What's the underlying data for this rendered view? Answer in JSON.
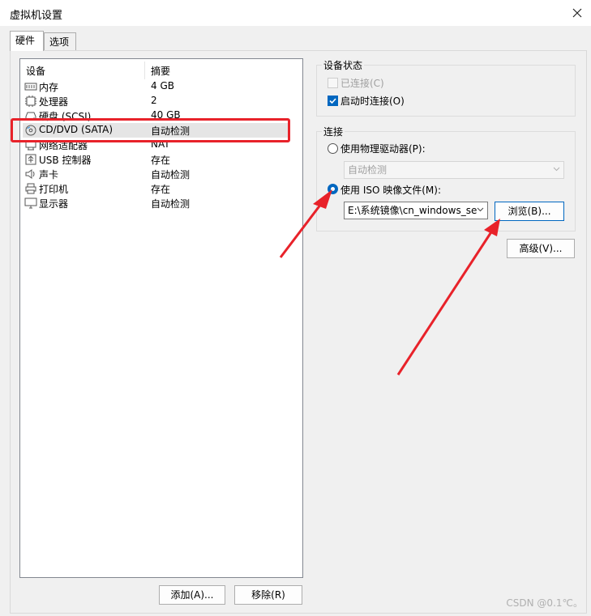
{
  "window": {
    "title": "虚拟机设置"
  },
  "tabs": [
    {
      "label": "硬件"
    },
    {
      "label": "选项"
    }
  ],
  "device_list": {
    "headers": {
      "device": "设备",
      "summary": "摘要"
    },
    "rows": [
      {
        "icon": "memory-icon",
        "name": "内存",
        "summary": "4 GB"
      },
      {
        "icon": "cpu-icon",
        "name": "处理器",
        "summary": "2"
      },
      {
        "icon": "harddisk-icon",
        "name": "硬盘 (SCSI)",
        "summary": "40 GB"
      },
      {
        "icon": "cd-icon",
        "name": "CD/DVD (SATA)",
        "summary": "自动检测"
      },
      {
        "icon": "network-icon",
        "name": "网络适配器",
        "summary": "NAT"
      },
      {
        "icon": "usb-icon",
        "name": "USB 控制器",
        "summary": "存在"
      },
      {
        "icon": "speaker-icon",
        "name": "声卡",
        "summary": "自动检测"
      },
      {
        "icon": "printer-icon",
        "name": "打印机",
        "summary": "存在"
      },
      {
        "icon": "monitor-icon",
        "name": "显示器",
        "summary": "自动检测"
      }
    ],
    "selected_index": 3
  },
  "buttons": {
    "add": "添加(A)...",
    "remove": "移除(R)",
    "browse": "浏览(B)...",
    "advanced": "高级(V)..."
  },
  "device_status": {
    "title": "设备状态",
    "connected": {
      "label": "已连接(C)",
      "checked": false,
      "enabled": false
    },
    "connect_at_power_on": {
      "label": "启动时连接(O)",
      "checked": true,
      "enabled": true
    }
  },
  "connection": {
    "title": "连接",
    "physical_drive": {
      "label": "使用物理驱动器(P):",
      "selected": false
    },
    "physical_drive_select": {
      "value": "自动检测"
    },
    "iso_file": {
      "label": "使用 ISO 映像文件(M):",
      "selected": true
    },
    "iso_path": {
      "value": "E:\\系统镜像\\cn_windows_se"
    }
  },
  "watermark": "CSDN @0.1℃。",
  "colors": {
    "accent": "#0067c0",
    "annotation": "#e8222a"
  }
}
